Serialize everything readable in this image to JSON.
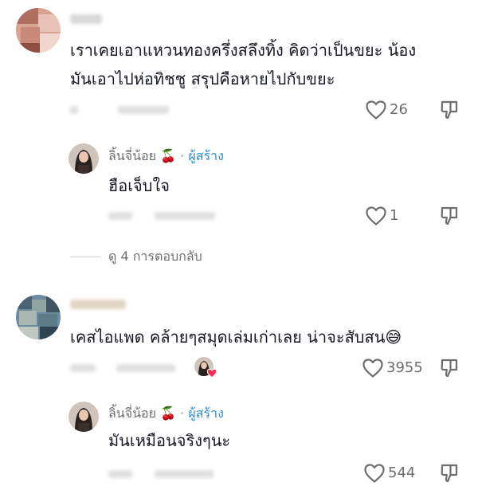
{
  "comments": [
    {
      "text_line1": "เราเคยเอาแหวนทองครึ่งสลึงทิ้ง คิดว่าเป็นขยะ น้อง",
      "text_line2": "มันเอาไปห่อทิชชู สรุปคือหายไปกับขยะ",
      "likes": "26",
      "reply": {
        "author": "ลิ้นจี่น้อย",
        "author_emoji": "🍒",
        "separator": "·",
        "badge": "ผู้สร้าง",
        "text": "ฮือเจ็บใจ",
        "likes": "1"
      },
      "view_replies": "ดู 4 การตอบกลับ"
    },
    {
      "text_line1": "เคสไอแพด คล้ายๆสมุดเล่มเก่าเลย น่าจะสับสน😅",
      "likes": "3955",
      "reply": {
        "author": "ลิ้นจี่น้อย",
        "author_emoji": "🍒",
        "separator": "·",
        "badge": "ผู้สร้าง",
        "text": "มันเหมือนจริงๆนะ",
        "likes": "544"
      }
    }
  ],
  "colors": {
    "text": "#161823",
    "secondary": "#6d6e72",
    "creator_badge": "#2a8fd1",
    "liked_heart": "#fe2c55"
  },
  "icons": [
    "heart-outline-icon",
    "dislike-icon",
    "cherry-icon",
    "heart-filled-icon"
  ]
}
